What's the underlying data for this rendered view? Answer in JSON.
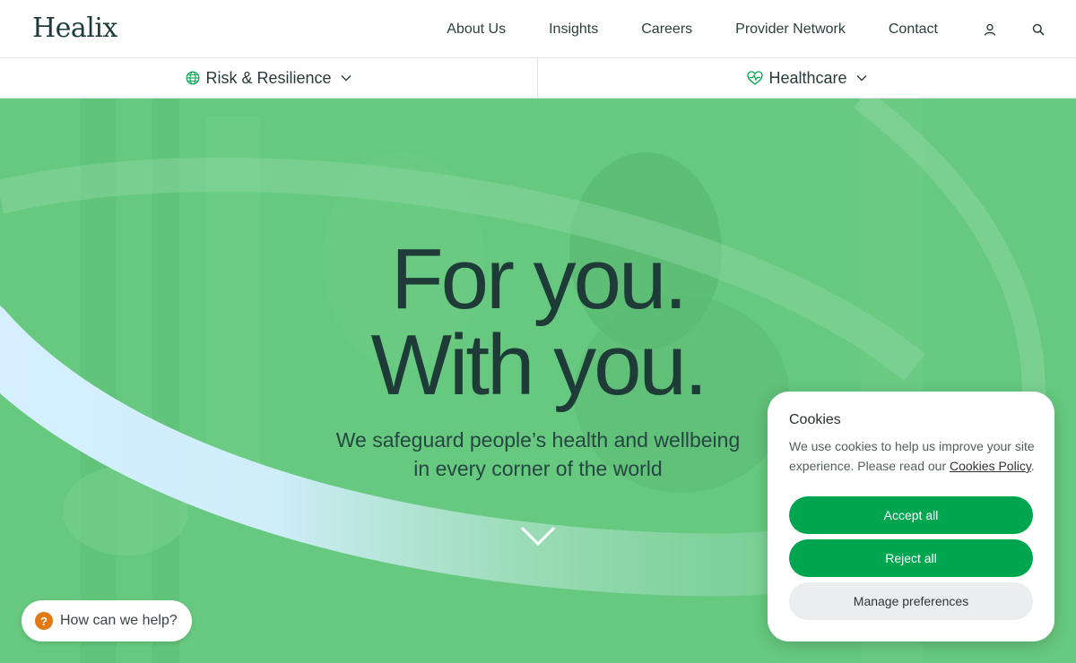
{
  "header": {
    "logo": "Healix",
    "nav": [
      "About Us",
      "Insights",
      "Careers",
      "Provider Network",
      "Contact"
    ],
    "icons": [
      "user-icon",
      "search-icon"
    ]
  },
  "subnav": {
    "left": {
      "label": "Risk & Resilience",
      "icon": "globe-icon"
    },
    "right": {
      "label": "Healthcare",
      "icon": "heart-pulse-icon"
    }
  },
  "hero": {
    "headline_1": "For you.",
    "headline_2": "With you.",
    "subline_1": "We safeguard people’s health and wellbeing",
    "subline_2": "in every corner of the world",
    "scroll_icon": "chevron-down-icon"
  },
  "help": {
    "icon": "question-icon",
    "glyph": "?",
    "label": "How can we help?"
  },
  "cookies": {
    "title": "Cookies",
    "body_prefix": "We use cookies to help us improve your site experience. Please read our ",
    "link": "Cookies Policy",
    "body_suffix": ".",
    "accept": "Accept all",
    "reject": "Reject all",
    "manage": "Manage preferences"
  },
  "colors": {
    "hero_green": "#67c97f",
    "button_green": "#00a550",
    "headline": "#1e3b38",
    "help_orange": "#e07b14"
  }
}
